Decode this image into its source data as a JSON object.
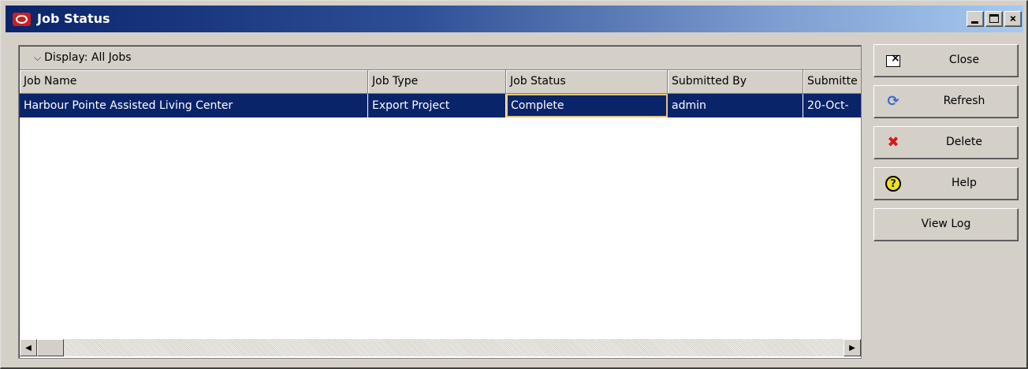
{
  "window": {
    "title": "Job Status",
    "controls": {
      "minimize": "_",
      "maximize": "□",
      "close": "×"
    }
  },
  "jobs_panel": {
    "display_filter": "Display: All Jobs",
    "columns": [
      "Job Name",
      "Job Type",
      "Job Status",
      "Submitted By",
      "Submitte"
    ],
    "rows": [
      [
        "Harbour Pointe Assisted Living Center",
        "Export Project",
        "Complete",
        "admin",
        "20-Oct-"
      ]
    ],
    "scroll": {
      "left_arrow": "◀",
      "right_arrow": "▶"
    }
  },
  "actions": {
    "close": "Close",
    "refresh": "Refresh",
    "delete": "Delete",
    "help": "Help",
    "view_log": "View Log"
  },
  "icons": {
    "app": "oracle-logo-icon",
    "close": "window-close-icon",
    "refresh": "refresh-icon",
    "delete": "delete-x-icon",
    "help": "help-question-icon",
    "chevron": "chevron-down-icon"
  },
  "colors": {
    "titlebar_start": "#0a246a",
    "titlebar_end": "#a6caf0",
    "selection": "#0a246a",
    "face": "#d4d0c8",
    "logo_red": "#cc1f1f",
    "delete_red": "#d21a1a"
  }
}
